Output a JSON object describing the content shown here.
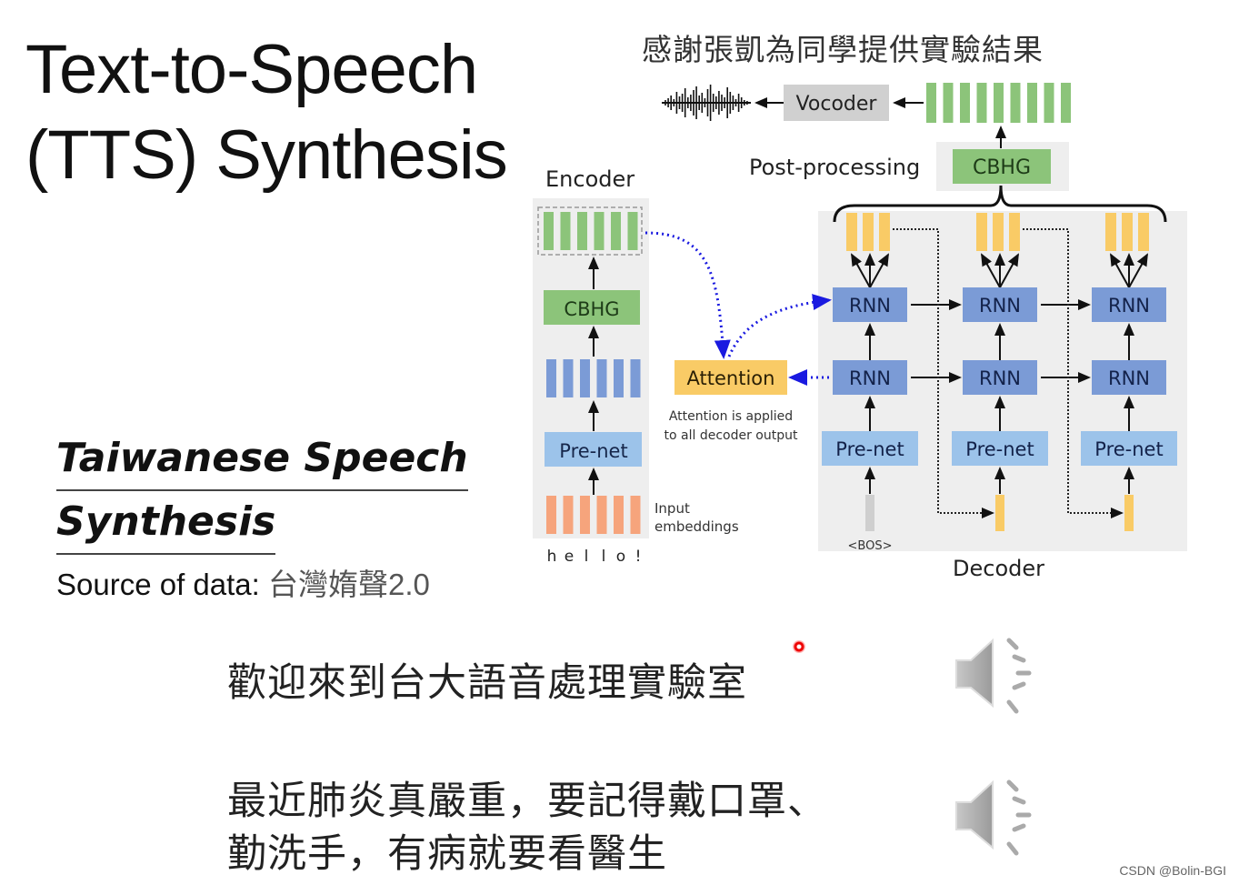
{
  "slide": {
    "title_line1": "Text-to-Speech",
    "title_line2": "(TTS) Synthesis",
    "credit": "感謝張凱為同學提供實驗結果",
    "subtitle_line1": "Taiwanese Speech",
    "subtitle_line2": "Synthesis",
    "source_label": "Source of data: ",
    "source_value": "台灣媠聲2.0",
    "samples": [
      {
        "text_line1": "歡迎來到台大語音處理實驗室",
        "audio_icon": "speaker-icon"
      },
      {
        "text_line1": "最近肺炎真嚴重，要記得戴口罩、",
        "text_line2": "勤洗手，有病就要看醫生",
        "audio_icon": "speaker-icon"
      }
    ],
    "watermark": "CSDN @Bolin-BGI"
  },
  "diagram": {
    "encoder_label": "Encoder",
    "decoder_label": "Decoder",
    "post_processing_label": "Post-processing",
    "vocoder_label": "Vocoder",
    "cbhg_label": "CBHG",
    "prenet_label": "Pre-net",
    "rnn_label": "RNN",
    "attention_label": "Attention",
    "attention_note_line1": "Attention is applied",
    "attention_note_line2": "to all decoder output",
    "input_embeddings_line1": "Input",
    "input_embeddings_line2": "embeddings",
    "input_chars": [
      "h",
      "e",
      "l",
      "l",
      "o",
      "!"
    ],
    "bos_label": "<BOS>",
    "colors": {
      "green": "#8cc47a",
      "blue_block": "#7b9bd6",
      "light_blue": "#9cc3ea",
      "orange": "#f6a47c",
      "yellow": "#f9cb66",
      "attention_arrow": "#1a1ae0",
      "panel": "#eeeeee"
    }
  }
}
